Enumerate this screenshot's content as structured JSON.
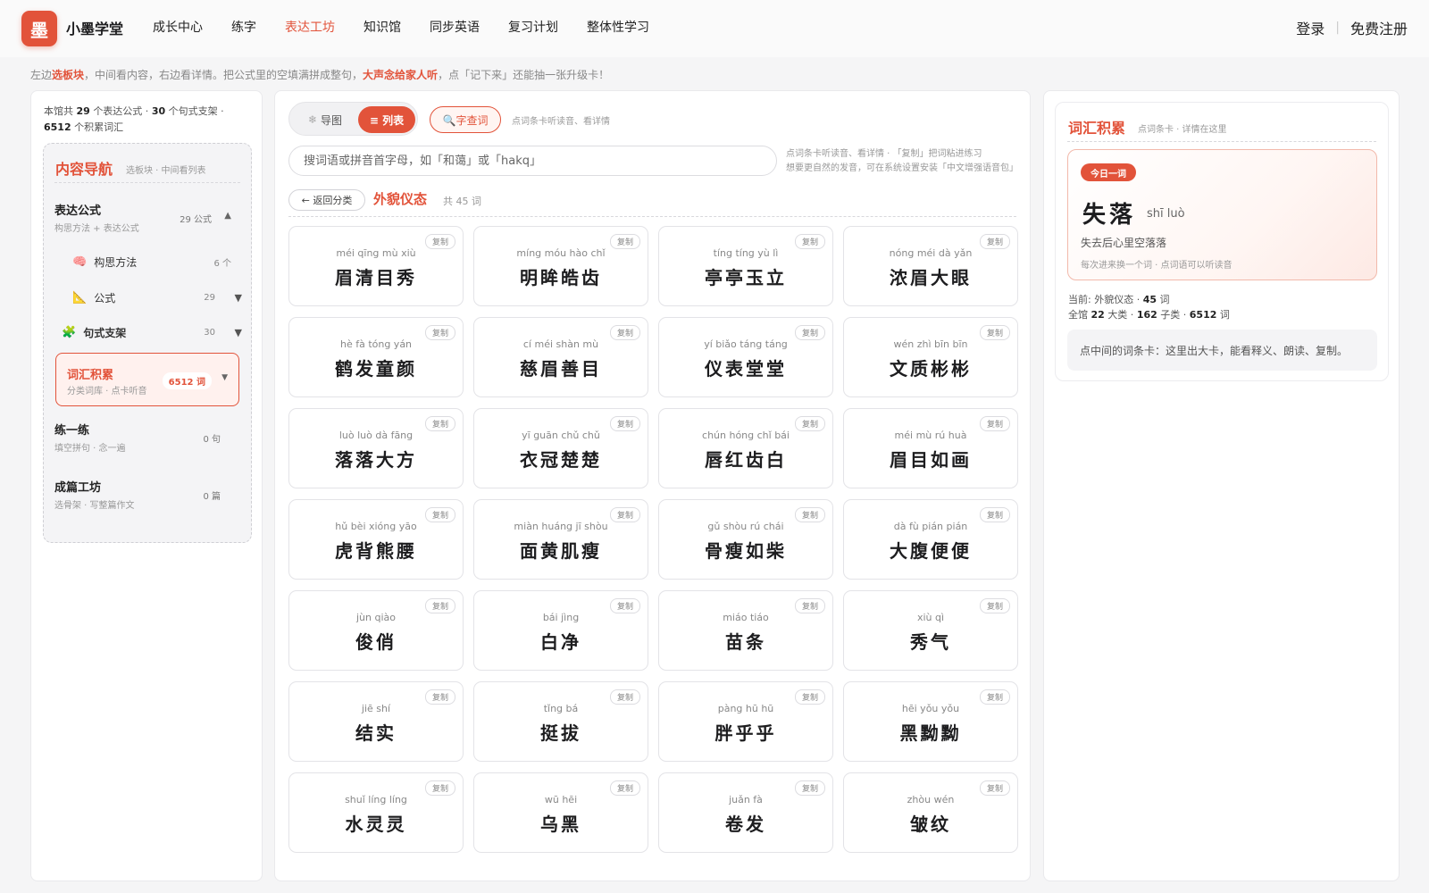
{
  "header": {
    "logo_char": "墨",
    "brand": "小墨学堂",
    "nav": [
      "成长中心",
      "练字",
      "表达工坊",
      "知识馆",
      "同步英语",
      "复习计划",
      "整体性学习"
    ],
    "active_nav": "表达工坊",
    "login": "登录",
    "register": "免费注册"
  },
  "tip": {
    "p1": "左边",
    "h1": "选板块",
    "p2": "，中间看内容，右边看详情。把公式里的空填满拼成整句，",
    "h2": "大声念给家人听",
    "p3": "，点「记下来」还能抽一张升级卡！"
  },
  "left": {
    "stats": {
      "l1": "本馆共",
      "n1": "29",
      "l2": "个表达公式 ·",
      "n2": "30",
      "l3": "个句式支架 ·",
      "n3": "6512",
      "l4": "个积累词汇"
    },
    "title": "内容导航",
    "subtitle": "选板块 · 中间看列表",
    "sections": {
      "formula": {
        "label": "表达公式",
        "desc": "构思方法 + 表达公式",
        "count": "29 公式",
        "arrow": "▲"
      },
      "method": {
        "icon": "🧠",
        "label": "构思方法",
        "count": "6 个"
      },
      "formula_sub": {
        "icon": "📐",
        "label": "公式",
        "count": "29",
        "arrow": "▼"
      },
      "scaffold": {
        "icon": "🧩",
        "label": "句式支架",
        "count": "30",
        "arrow": "▼"
      },
      "vocab": {
        "label": "词汇积累",
        "desc": "分类词库 · 点卡听音",
        "badge": "6512 词",
        "arrow": "▼"
      },
      "practice": {
        "label": "练一练",
        "desc": "填空拼句 · 念一遍",
        "count": "0 句"
      },
      "essay": {
        "label": "成篇工坊",
        "desc": "选骨架 · 写整篇作文",
        "count": "0 篇"
      }
    }
  },
  "center": {
    "mode_map": "导图",
    "mode_map_icon": "❄",
    "mode_list": "≡ 列表",
    "lookup": "🔍字查词",
    "lookup_hint": "点词条卡听读音、看详情",
    "search_placeholder": "搜词语或拼音首字母，如「和蔼」或「hakq」",
    "search_hint_1": "点词条卡听读音、看详情 · 「复制」把词粘进练习",
    "search_hint_2": "想要更自然的发音，可在系统设置安装「中文增强语音包」",
    "back": "← 返回分类",
    "category": "外貌仪态",
    "category_count": "共 45 词",
    "copy_label": "复制",
    "words": [
      {
        "py": "méi qīng mù xiù",
        "w": "眉清目秀"
      },
      {
        "py": "míng móu hào chǐ",
        "w": "明眸皓齿"
      },
      {
        "py": "tíng tíng yù lì",
        "w": "亭亭玉立"
      },
      {
        "py": "nóng méi dà yǎn",
        "w": "浓眉大眼"
      },
      {
        "py": "hè fà tóng yán",
        "w": "鹤发童颜"
      },
      {
        "py": "cí méi shàn mù",
        "w": "慈眉善目"
      },
      {
        "py": "yí biǎo táng táng",
        "w": "仪表堂堂"
      },
      {
        "py": "wén zhì bīn bīn",
        "w": "文质彬彬"
      },
      {
        "py": "luò luò dà fāng",
        "w": "落落大方"
      },
      {
        "py": "yī guān chǔ chǔ",
        "w": "衣冠楚楚"
      },
      {
        "py": "chún hóng chǐ bái",
        "w": "唇红齿白"
      },
      {
        "py": "méi mù rú huà",
        "w": "眉目如画"
      },
      {
        "py": "hǔ bèi xióng yāo",
        "w": "虎背熊腰"
      },
      {
        "py": "miàn huáng jī shòu",
        "w": "面黄肌瘦"
      },
      {
        "py": "gǔ shòu rú chái",
        "w": "骨瘦如柴"
      },
      {
        "py": "dà fù pián pián",
        "w": "大腹便便"
      },
      {
        "py": "jùn qiào",
        "w": "俊俏"
      },
      {
        "py": "bái jìng",
        "w": "白净"
      },
      {
        "py": "miáo tiáo",
        "w": "苗条"
      },
      {
        "py": "xiù qì",
        "w": "秀气"
      },
      {
        "py": "jiē shí",
        "w": "结实"
      },
      {
        "py": "tǐng bá",
        "w": "挺拔"
      },
      {
        "py": "pàng hū hū",
        "w": "胖乎乎"
      },
      {
        "py": "hēi yǒu yǒu",
        "w": "黑黝黝"
      },
      {
        "py": "shuǐ líng líng",
        "w": "水灵灵"
      },
      {
        "py": "wū hēi",
        "w": "乌黑"
      },
      {
        "py": "juǎn fà",
        "w": "卷发"
      },
      {
        "py": "zhòu wén",
        "w": "皱纹"
      }
    ]
  },
  "right": {
    "title": "词汇积累",
    "subtitle": "点词条卡 · 详情在这里",
    "daily_tag": "今日一词",
    "daily_word": "失落",
    "daily_py": "shī luò",
    "daily_meaning": "失去后心里空落落",
    "daily_note": "每次进来换一个词 · 点词语可以听读音",
    "current_label": "当前: 外貌仪态 ·",
    "current_count": "45",
    "current_unit": "词",
    "total_l1": "全馆",
    "total_n1": "22",
    "total_l2": "大类 ·",
    "total_n2": "162",
    "total_l3": "子类 ·",
    "total_n3": "6512",
    "total_l4": "词",
    "info": "点中间的词条卡：这里出大卡，能看释义、朗读、复制。"
  },
  "colors": {
    "accent": "#e2533a",
    "bg": "#f5f5f6"
  }
}
